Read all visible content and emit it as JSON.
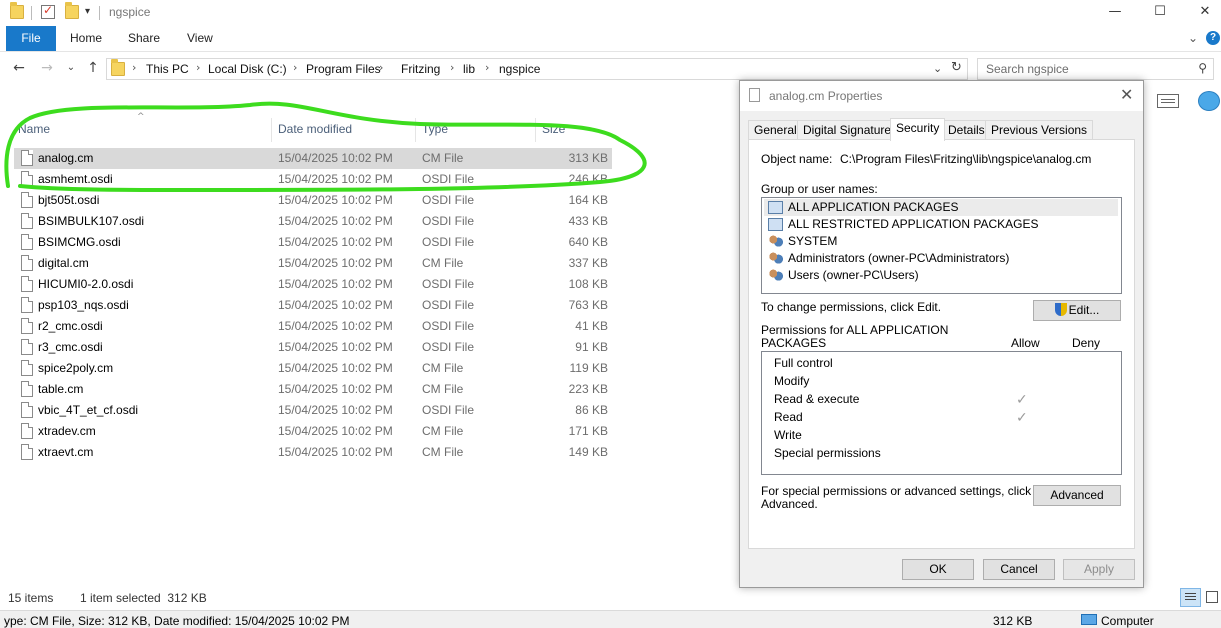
{
  "window": {
    "title": "ngspice",
    "controls": {
      "minimize": "—",
      "maximize": "☐",
      "close": "✕"
    }
  },
  "ribbon": {
    "file_tab": "File",
    "tabs": [
      "Home",
      "Share",
      "View"
    ],
    "expand_icon": "chevron-down-icon",
    "help_icon": "help-icon"
  },
  "address": {
    "crumbs": [
      "This PC",
      "Local Disk (C:)",
      "Program Files",
      "Fritzing",
      "lib",
      "ngspice"
    ]
  },
  "search": {
    "placeholder": "Search ngspice"
  },
  "file_list": {
    "headers": {
      "name": "Name",
      "date": "Date modified",
      "type": "Type",
      "size": "Size"
    },
    "rows": [
      {
        "name": "analog.cm",
        "date": "15/04/2025 10:02 PM",
        "type": "CM File",
        "size": "313 KB",
        "selected": true
      },
      {
        "name": "asmhemt.osdi",
        "date": "15/04/2025 10:02 PM",
        "type": "OSDI File",
        "size": "246 KB"
      },
      {
        "name": "bjt505t.osdi",
        "date": "15/04/2025 10:02 PM",
        "type": "OSDI File",
        "size": "164 KB"
      },
      {
        "name": "BSIMBULK107.osdi",
        "date": "15/04/2025 10:02 PM",
        "type": "OSDI File",
        "size": "433 KB"
      },
      {
        "name": "BSIMCMG.osdi",
        "date": "15/04/2025 10:02 PM",
        "type": "OSDI File",
        "size": "640 KB"
      },
      {
        "name": "digital.cm",
        "date": "15/04/2025 10:02 PM",
        "type": "CM File",
        "size": "337 KB"
      },
      {
        "name": "HICUMI0-2.0.osdi",
        "date": "15/04/2025 10:02 PM",
        "type": "OSDI File",
        "size": "108 KB"
      },
      {
        "name": "psp103_nqs.osdi",
        "date": "15/04/2025 10:02 PM",
        "type": "OSDI File",
        "size": "763 KB"
      },
      {
        "name": "r2_cmc.osdi",
        "date": "15/04/2025 10:02 PM",
        "type": "OSDI File",
        "size": "41 KB"
      },
      {
        "name": "r3_cmc.osdi",
        "date": "15/04/2025 10:02 PM",
        "type": "OSDI File",
        "size": "91 KB"
      },
      {
        "name": "spice2poly.cm",
        "date": "15/04/2025 10:02 PM",
        "type": "CM File",
        "size": "119 KB"
      },
      {
        "name": "table.cm",
        "date": "15/04/2025 10:02 PM",
        "type": "CM File",
        "size": "223 KB"
      },
      {
        "name": "vbic_4T_et_cf.osdi",
        "date": "15/04/2025 10:02 PM",
        "type": "OSDI File",
        "size": "86 KB"
      },
      {
        "name": "xtradev.cm",
        "date": "15/04/2025 10:02 PM",
        "type": "CM File",
        "size": "171 KB"
      },
      {
        "name": "xtraevt.cm",
        "date": "15/04/2025 10:02 PM",
        "type": "CM File",
        "size": "149 KB"
      }
    ]
  },
  "status": {
    "items_count": "15 items",
    "selection": "1 item selected  312 KB",
    "details": "ype: CM File, Size: 312 KB, Date modified: 15/04/2025 10:02 PM",
    "size": "312 KB",
    "computer": "Computer"
  },
  "dialog": {
    "title": "analog.cm Properties",
    "tabs": [
      "General",
      "Digital Signatures",
      "Security",
      "Details",
      "Previous Versions"
    ],
    "active_tab": "Security",
    "object_name_label": "Object name:",
    "object_name_value": "C:\\Program Files\\Fritzing\\lib\\ngspice\\analog.cm",
    "group_label": "Group or user names:",
    "users": [
      {
        "name": "ALL APPLICATION PACKAGES",
        "icon": "package-group-icon",
        "selected": true
      },
      {
        "name": "ALL RESTRICTED APPLICATION PACKAGES",
        "icon": "package-group-icon"
      },
      {
        "name": "SYSTEM",
        "icon": "users-icon"
      },
      {
        "name": "Administrators (owner-PC\\Administrators)",
        "icon": "users-icon"
      },
      {
        "name": "Users (owner-PC\\Users)",
        "icon": "users-icon"
      }
    ],
    "change_perm_text": "To change permissions, click Edit.",
    "edit_button": "Edit...",
    "permissions_for_line1": "Permissions for ALL APPLICATION",
    "permissions_for_line2": "PACKAGES",
    "allow_label": "Allow",
    "deny_label": "Deny",
    "permissions": [
      {
        "name": "Full control",
        "allow": false
      },
      {
        "name": "Modify",
        "allow": false
      },
      {
        "name": "Read & execute",
        "allow": true
      },
      {
        "name": "Read",
        "allow": true
      },
      {
        "name": "Write",
        "allow": false
      },
      {
        "name": "Special permissions",
        "allow": false
      }
    ],
    "special_text_line1": "For special permissions or advanced settings, click",
    "special_text_line2": "Advanced.",
    "advanced_button": "Advanced",
    "ok_button": "OK",
    "cancel_button": "Cancel",
    "apply_button": "Apply"
  },
  "colors": {
    "file_tab_bg": "#1979ca",
    "annotation_green": "#3ddc1e",
    "selection_bg": "#d9d9d9"
  }
}
